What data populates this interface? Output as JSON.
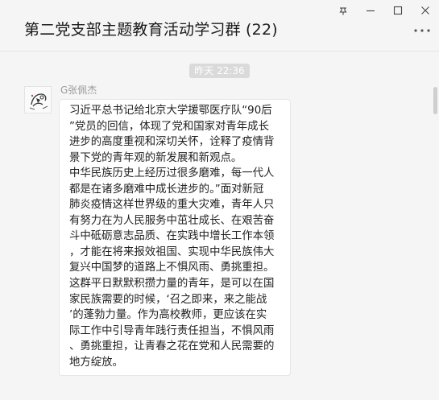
{
  "window_controls": {
    "pin_icon": "pin-icon",
    "minimize_icon": "minimize-icon",
    "maximize_icon": "maximize-icon",
    "close_icon": "close-icon"
  },
  "header": {
    "title": "第二党支部主题教育活动学习群 (22)",
    "more_icon": "more-dots-icon"
  },
  "chat": {
    "time_divider": "昨天 22:36",
    "message": {
      "sender": "G张佩杰",
      "avatar_icon": "avatar-sketch",
      "lines": [
        "习近平总书记给北京大学援鄂医疗队“90后",
        "”党员的回信，体现了党和国家对青年成长",
        "进步的高度重视和深切关怀，诠释了疫情背",
        "景下党的青年观的新发展和新观点。",
        "中华民族历史上经历过很多磨难，每一代人",
        "都是在诸多磨难中成长进步的。”面对新冠",
        "肺炎疫情这样世界级的重大灾难，青年人只",
        "有努力在为人民服务中茁壮成长、在艰苦奋",
        "斗中砥砺意志品质、在实践中增长工作本领",
        "，才能在将来报效祖国、实现中华民族伟大",
        "复兴中国梦的道路上不惧风雨、勇挑重担。",
        "这群平日默默积攒力量的青年，是可以在国",
        "家民族需要的时候，‘召之即来，来之能战",
        "’的蓬勃力量。作为高校教师，更应该在实",
        "际工作中引导青年践行责任担当，不惧风雨",
        "、勇挑重担，让青春之花在党和人民需要的",
        "地方绽放。"
      ]
    }
  },
  "colors": {
    "background": "#f5f5f5",
    "bubble": "#ffffff",
    "time_pill": "#dadada",
    "sender_text": "#9b9b9b"
  }
}
